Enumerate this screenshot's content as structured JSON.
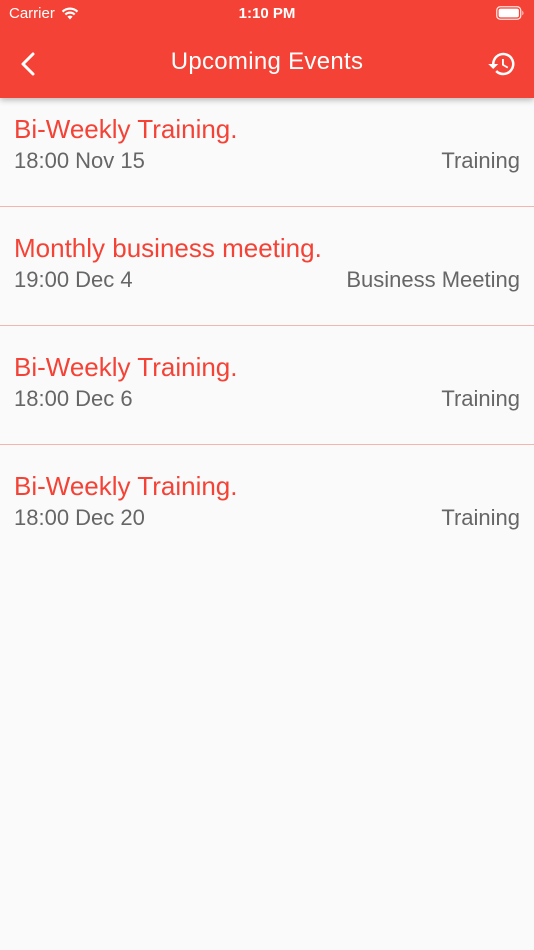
{
  "status_bar": {
    "carrier": "Carrier",
    "time": "1:10 PM"
  },
  "appbar": {
    "title": "Upcoming Events",
    "back_icon": "chevron-left-icon",
    "history_icon": "history-icon",
    "background_color": "#f44336"
  },
  "events": [
    {
      "title": "Bi-Weekly Training.",
      "time": "18:00 Nov 15",
      "type": "Training"
    },
    {
      "title": "Monthly business meeting.",
      "time": "19:00 Dec 4",
      "type": "Business Meeting"
    },
    {
      "title": "Bi-Weekly Training.",
      "time": "18:00 Dec 6",
      "type": "Training"
    },
    {
      "title": "Bi-Weekly Training.",
      "time": "18:00 Dec 20",
      "type": "Training"
    }
  ],
  "colors": {
    "accent": "#f44336",
    "secondary_text": "#666666",
    "divider": "#f2b5b0",
    "background": "#fafafa"
  }
}
